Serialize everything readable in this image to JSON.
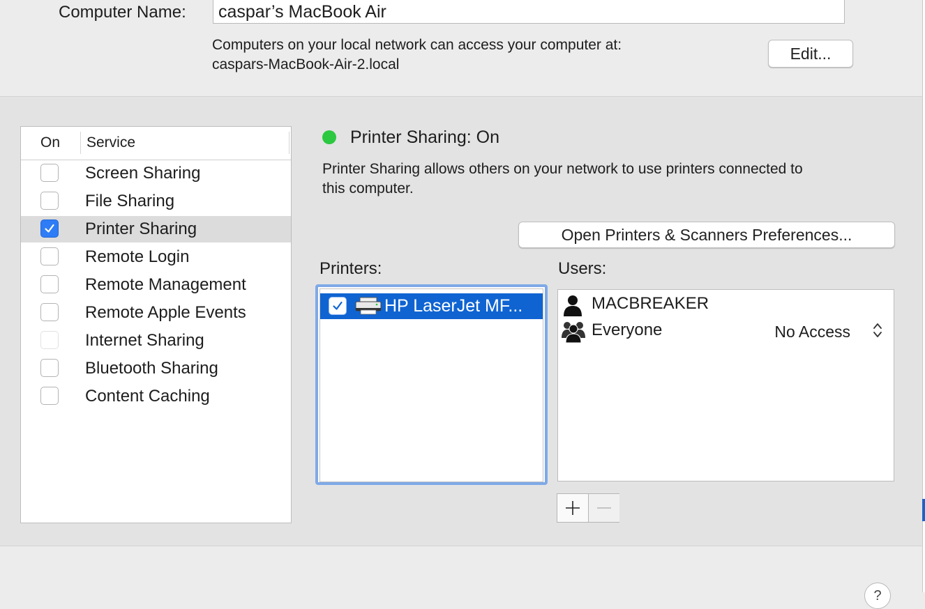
{
  "computer_name": {
    "label": "Computer Name:",
    "value": "caspar’s MacBook Air",
    "access_text_line1": "Computers on your local network can access your computer at:",
    "access_text_line2": "caspars-MacBook-Air-2.local",
    "edit_button": "Edit..."
  },
  "services": {
    "header_on": "On",
    "header_service": "Service",
    "items": [
      {
        "label": "Screen Sharing",
        "checked": false,
        "selected": false,
        "enabled": true
      },
      {
        "label": "File Sharing",
        "checked": false,
        "selected": false,
        "enabled": true
      },
      {
        "label": "Printer Sharing",
        "checked": true,
        "selected": true,
        "enabled": true
      },
      {
        "label": "Remote Login",
        "checked": false,
        "selected": false,
        "enabled": true
      },
      {
        "label": "Remote Management",
        "checked": false,
        "selected": false,
        "enabled": true
      },
      {
        "label": "Remote Apple Events",
        "checked": false,
        "selected": false,
        "enabled": true
      },
      {
        "label": "Internet Sharing",
        "checked": false,
        "selected": false,
        "enabled": false
      },
      {
        "label": "Bluetooth Sharing",
        "checked": false,
        "selected": false,
        "enabled": true
      },
      {
        "label": "Content Caching",
        "checked": false,
        "selected": false,
        "enabled": true
      }
    ]
  },
  "detail": {
    "status": "Printer Sharing: On",
    "status_color": "#2bc840",
    "description_line1": "Printer Sharing allows others on your network to use printers connected to",
    "description_line2": "this computer.",
    "open_prefs_button": "Open Printers & Scanners Preferences...",
    "printers_label": "Printers:",
    "users_label": "Users:",
    "printers": [
      {
        "name": "HP LaserJet MF...",
        "checked": true,
        "icon": "printer-icon"
      }
    ],
    "users": [
      {
        "name": "MACBREAKER",
        "icon": "single-user-icon",
        "permission": ""
      },
      {
        "name": "Everyone",
        "icon": "group-users-icon",
        "permission": "No Access"
      }
    ],
    "add_button": "+",
    "remove_button": "−"
  },
  "help_button": "?",
  "colors": {
    "selection_blue": "#0f64d2",
    "focus_ring": "#7fa9e7",
    "checkbox_blue": "#2e7cf6"
  }
}
